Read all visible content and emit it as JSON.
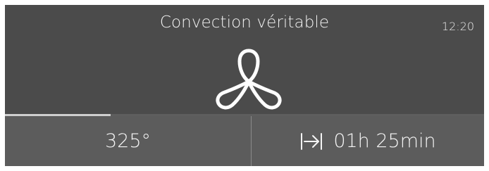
{
  "header": {
    "mode_title": "Convection véritable",
    "clock": "12:20"
  },
  "mode_icon": "fan-icon",
  "progress": {
    "fraction": 0.22
  },
  "temperature": {
    "value": "325°"
  },
  "timer": {
    "icon": "duration-arrow-icon",
    "value": "01h 25min"
  },
  "colors": {
    "background": "#4b4b4b",
    "bottom_panel": "#5c5c5c",
    "text": "#f2f2f2",
    "progress_fill": "#cfcfcf"
  }
}
